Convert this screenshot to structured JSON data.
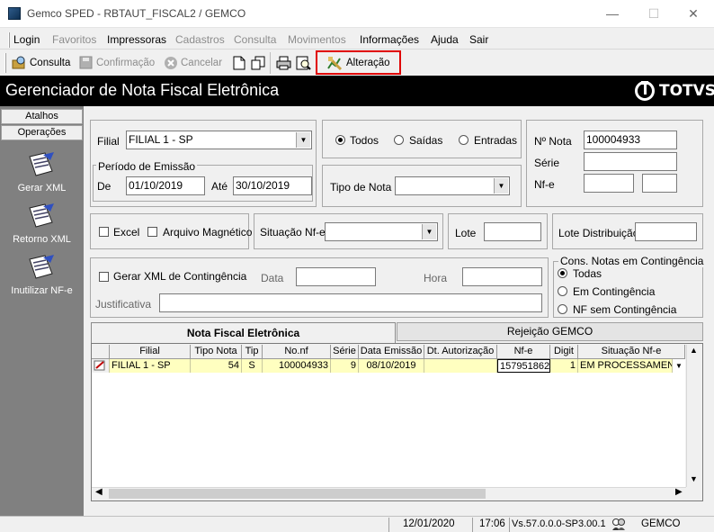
{
  "window": {
    "title": "Gemco SPED - RBTAUT_FISCAL2 / GEMCO",
    "minimize": "—",
    "maximize": "☐",
    "close": "✕"
  },
  "menu": {
    "items": [
      "Login",
      "Favoritos",
      "Impressoras",
      "Cadastros",
      "Consulta",
      "Movimentos",
      "Informações",
      "Ajuda",
      "Sair"
    ]
  },
  "toolbar": {
    "consulta": "Consulta",
    "confirmacao": "Confirmação",
    "cancelar": "Cancelar",
    "alteracao": "Alteração",
    "highlight_color": "#e00000"
  },
  "header": {
    "title": "Gerenciador de Nota Fiscal Eletrônica",
    "logo": "TOTVS"
  },
  "sidebar": {
    "tabs": [
      "Atalhos",
      "Operações"
    ],
    "items": [
      "Gerar XML",
      "Retorno XML",
      "Inutilizar NF-e"
    ]
  },
  "filters": {
    "filial_label": "Filial",
    "filial_value": "FILIAL 1 - SP",
    "periodo_legend": "Período de Emissão",
    "de_label": "De",
    "de_value": "01/10/2019",
    "ate_label": "Até",
    "ate_value": "30/10/2019",
    "tipo_radio": [
      "Todos",
      "Saídas",
      "Entradas"
    ],
    "tipo_selected": "Todos",
    "tipo_nota_label": "Tipo de Nota",
    "tipo_nota_value": "",
    "nnota_label": "Nº Nota",
    "nnota_value": "100004933",
    "serie_label": "Série",
    "serie_value": "",
    "nfe_label": "Nf-e",
    "excel_label": "Excel",
    "arquivo_label": "Arquivo Magnético",
    "situacao_label": "Situação Nf-e",
    "situacao_value": "",
    "lote_label": "Lote",
    "lote_value": "",
    "lote_dist_label": "Lote Distribuição",
    "lote_dist_value": "",
    "gerar_xml_label": "Gerar XML de Contingência",
    "data_label": "Data",
    "hora_label": "Hora",
    "justificativa_label": "Justificativa",
    "cons_legend": "Cons. Notas em Contingência",
    "cons_options": [
      "Todas",
      "Em Contingência",
      "NF sem Contingência"
    ],
    "cons_selected": "Todas"
  },
  "tabs": [
    "Nota Fiscal Eletrônica",
    "Rejeição GEMCO"
  ],
  "table": {
    "columns": [
      "Filial",
      "Tipo Nota",
      "Tip",
      "No.nf",
      "Série",
      "Data Emissão",
      "Dt. Autorização",
      "Nf-e",
      "Digit",
      "Situação Nf-e"
    ],
    "rows": [
      [
        "FILIAL 1 - SP",
        "54",
        "S",
        "100004933",
        "9",
        "08/10/2019",
        "",
        "157951862",
        "1",
        "EM PROCESSAMEN"
      ]
    ]
  },
  "status": {
    "date": "12/01/2020",
    "time": "17:06",
    "version": "Vs.57.0.0.0-SP3.00.1",
    "user": "GEMCO"
  }
}
